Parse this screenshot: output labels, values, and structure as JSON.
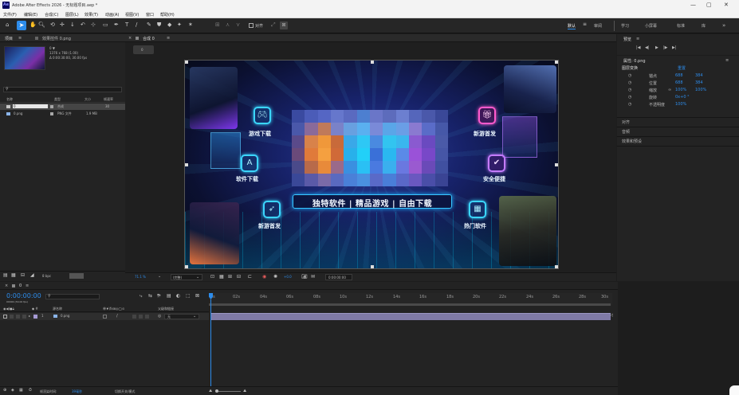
{
  "window": {
    "title": "Adobe After Effects 2026 - 无标题项目.aep *",
    "app_badge": "Ae",
    "controls": [
      "—",
      "▢",
      "✕"
    ]
  },
  "menu": [
    "文件(F)",
    "编辑(E)",
    "合成(C)",
    "图层(L)",
    "效果(T)",
    "动画(A)",
    "视图(V)",
    "窗口",
    "帮助(H)"
  ],
  "toolbar": {
    "snap_label": "对齐",
    "workspaces": [
      "默认",
      "审阅",
      "学习",
      "小屏幕",
      "标准",
      "库"
    ],
    "active_workspace": "默认",
    "more": "»"
  },
  "project": {
    "tab_label": "项目",
    "effect_tab": "效果控件 0.png",
    "thumb_info": [
      "0 ▼",
      "1376 x 768 (1.00)",
      "Δ 0:00:30:00, 30.00 fps"
    ],
    "search_placeholder": "",
    "columns": [
      "名称",
      "类型",
      "大小",
      "帧速率"
    ],
    "items": [
      {
        "name": "0",
        "type": "合成",
        "size": "",
        "fps": "30"
      },
      {
        "name": "0.png",
        "type": "PNG 文件",
        "size": "1.9 MB",
        "fps": ""
      }
    ],
    "bpc": "8 bpc"
  },
  "composition": {
    "tab_label": "合成 0",
    "breadcrumb": "0",
    "banner_slogan": "独特软件 | 精品游戏 | 自由下载",
    "features": [
      "游戏下载",
      "新游首发",
      "软件下载",
      "安全便捷",
      "新游首发",
      "热门软件"
    ],
    "zoom": "71.1 %",
    "quality": "(完整)",
    "exposure": "+0.0",
    "timecode": "0:00:00:00"
  },
  "preview": {
    "tab_label": "预览",
    "buttons": [
      "|◀",
      "◀|",
      "▶",
      "|▶",
      "▶|"
    ]
  },
  "properties": {
    "tab_label": "属性: 0.png",
    "section": "图层变换",
    "reset": "重置",
    "rows": [
      {
        "label": "锚点",
        "v1": "688",
        "v2": "384"
      },
      {
        "label": "位置",
        "v1": "688",
        "v2": "384"
      },
      {
        "label": "缩放",
        "v1": "100%",
        "v2": "100%"
      },
      {
        "label": "旋转",
        "v1": "0x+0 °",
        "v2": ""
      },
      {
        "label": "不透明度",
        "v1": "100%",
        "v2": ""
      }
    ],
    "sections": [
      "对齐",
      "音频",
      "效果和预设"
    ]
  },
  "timeline": {
    "tab_label": "0",
    "timecode": "0:00:00:00",
    "fps_sub": "00000 (30.00 fps)",
    "search_placeholder": "",
    "col_source": "源名称",
    "col_switches": "单♦\\fx⊞◎◯⊙",
    "col_parent": "父级和链接",
    "layer": {
      "index": "1",
      "name": "0.png",
      "parent": "无"
    },
    "ruler": [
      "0s",
      "02s",
      "04s",
      "06s",
      "08s",
      "10s",
      "12s",
      "14s",
      "16s",
      "18s",
      "20s",
      "22s",
      "24s",
      "26s",
      "28s",
      "30s"
    ],
    "footer_render": "帧渲染时间:",
    "footer_ms": "39毫秒",
    "footer_toggle": "切换开关/模式"
  }
}
